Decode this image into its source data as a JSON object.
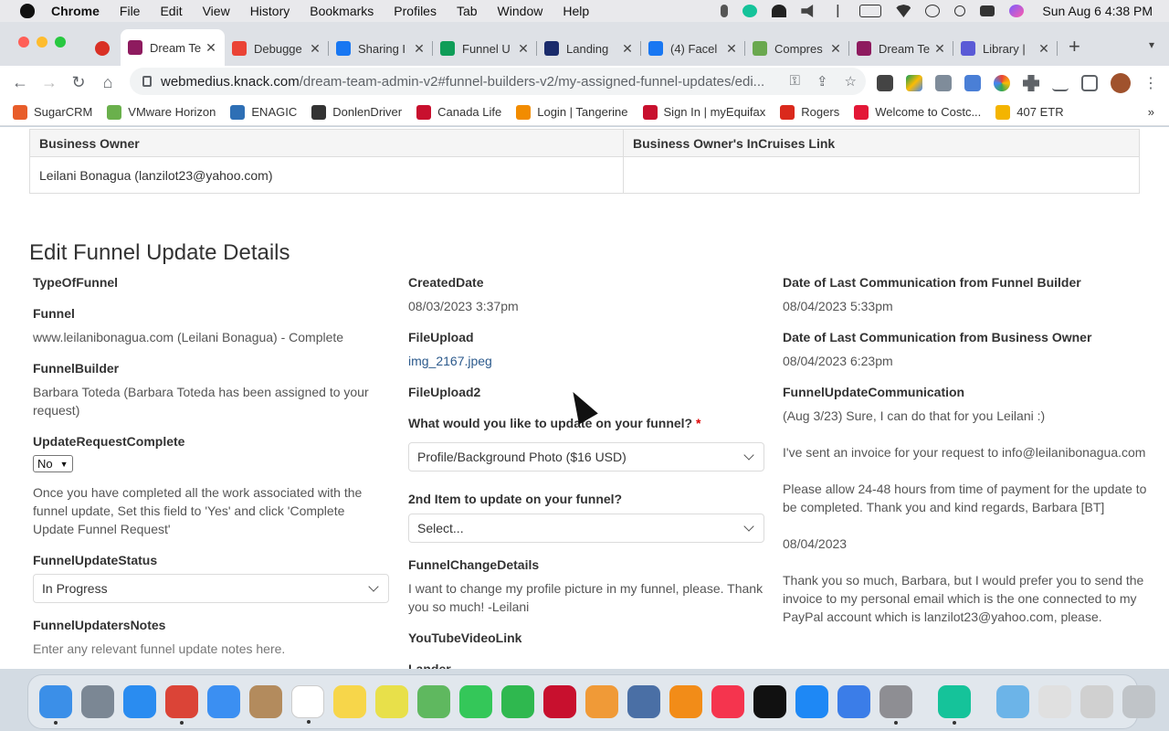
{
  "menubar": {
    "app_name": "Chrome",
    "items": [
      "File",
      "Edit",
      "View",
      "History",
      "Bookmarks",
      "Profiles",
      "Tab",
      "Window",
      "Help"
    ],
    "clock": "Sun Aug 6  4:38 PM"
  },
  "tabs": [
    {
      "title": "",
      "icon": "record-icon",
      "color": "#d93025"
    },
    {
      "title": "Dream Te",
      "icon": "knack-icon",
      "color": "#8e1b5f",
      "active": true
    },
    {
      "title": "Debugge",
      "icon": "gmail-icon",
      "color": "#ea4335"
    },
    {
      "title": "Sharing I",
      "icon": "facebook-icon",
      "color": "#1877f2"
    },
    {
      "title": "Funnel U",
      "icon": "sheets-icon",
      "color": "#0f9d58"
    },
    {
      "title": "Landing",
      "icon": "vimeo-icon",
      "color": "#1a2b6b"
    },
    {
      "title": "(4) Facel",
      "icon": "facebook-icon",
      "color": "#1877f2"
    },
    {
      "title": "Compres",
      "icon": "compress-icon",
      "color": "#6aa84f"
    },
    {
      "title": "Dream Te",
      "icon": "knack-icon",
      "color": "#8e1b5f"
    },
    {
      "title": "Library |",
      "icon": "library-icon",
      "color": "#5a5ad6"
    }
  ],
  "url": {
    "host": "webmedius.knack.com",
    "path": "/dream-team-admin-v2#funnel-builders-v2/my-assigned-funnel-updates/edi..."
  },
  "bookmarks": [
    {
      "label": "SugarCRM",
      "color": "#e85d2a"
    },
    {
      "label": "VMware Horizon",
      "color": "#6ab04c"
    },
    {
      "label": "ENAGIC",
      "color": "#2e6fb5"
    },
    {
      "label": "DonlenDriver",
      "color": "#333333"
    },
    {
      "label": "Canada Life",
      "color": "#c8102e"
    },
    {
      "label": "Login | Tangerine",
      "color": "#f28c00"
    },
    {
      "label": "Sign In | myEquifax",
      "color": "#c8102e"
    },
    {
      "label": "Rogers",
      "color": "#da291c"
    },
    {
      "label": "Welcome to Costc...",
      "color": "#e31837"
    },
    {
      "label": "407 ETR",
      "color": "#f4b400"
    }
  ],
  "owner_table": {
    "headers": [
      "Business Owner",
      "Business Owner's InCruises Link"
    ],
    "row": [
      "Leilani Bonagua (lanzilot23@yahoo.com)",
      ""
    ]
  },
  "section_title": "Edit Funnel Update Details",
  "col1": {
    "type_of_funnel_label": "TypeOfFunnel",
    "funnel_label": "Funnel",
    "funnel_value": "www.leilanibonagua.com (Leilani Bonagua) - Complete",
    "funnel_builder_label": "FunnelBuilder",
    "funnel_builder_value": "Barbara Toteda (Barbara Toteda has been assigned to your request)",
    "complete_label": "UpdateRequestComplete",
    "complete_value": "No",
    "complete_help": "Once you have completed all the work associated with the funnel update, Set this field to 'Yes' and click 'Complete Update Funnel Request'",
    "status_label": "FunnelUpdateStatus",
    "status_value": "In Progress",
    "notes_label": "FunnelUpdatersNotes",
    "notes_placeholder": "Enter any relevant funnel update notes here."
  },
  "col2": {
    "created_label": "CreatedDate",
    "created_value": "08/03/2023 3:37pm",
    "fileupload_label": "FileUpload",
    "fileupload_value": "img_2167.jpeg",
    "fileupload2_label": "FileUpload2",
    "update_q_label": "What would you like to update on your funnel?",
    "required_mark": "*",
    "update_q_value": "Profile/Background Photo ($16 USD)",
    "second_item_label": "2nd Item to update on your funnel?",
    "second_item_value": "Select...",
    "change_details_label": "FunnelChangeDetails",
    "change_details_value": "I want to change my profile picture in my funnel, please. Thank you so much! -Leilani",
    "youtube_label": "YouTubeVideoLink",
    "lander_label": "Lander"
  },
  "col3": {
    "last_fb_label": "Date of Last Communication from Funnel Builder",
    "last_fb_value": "08/04/2023 5:33pm",
    "last_bo_label": "Date of Last Communication from Business Owner",
    "last_bo_value": "08/04/2023 6:23pm",
    "comm_label": "FunnelUpdateCommunication",
    "comm_line1": "(Aug 3/23) Sure, I can do that for you Leilani :)",
    "comm_line2": "I've sent an invoice for your request to info@leilanibonagua.com",
    "comm_line3": "Please allow 24-48 hours from time of payment for the update to be completed. Thank you and kind regards, Barbara [BT]",
    "comm_line4": "08/04/2023",
    "comm_line5": "Thank you so much, Barbara, but I would prefer you to send the invoice to my personal email which is the one connected to my PayPal account which is lanzilot23@yahoo.com, please."
  },
  "dock": [
    {
      "name": "finder-icon",
      "color": "#3b8fe8",
      "running": true
    },
    {
      "name": "launchpad-icon",
      "color": "#7b8794"
    },
    {
      "name": "safari-icon",
      "color": "#2a8cf0"
    },
    {
      "name": "chrome-icon",
      "color": "#db4437",
      "running": true
    },
    {
      "name": "mail-icon",
      "color": "#3b8ff2"
    },
    {
      "name": "contacts-icon",
      "color": "#b38b5d"
    },
    {
      "name": "calendar-icon",
      "color": "#ffffff",
      "running": true
    },
    {
      "name": "notes-icon",
      "color": "#f7d64a"
    },
    {
      "name": "stickies-icon",
      "color": "#e8e04a"
    },
    {
      "name": "maps-icon",
      "color": "#5fb85f"
    },
    {
      "name": "messages-icon",
      "color": "#34c759"
    },
    {
      "name": "facetime-icon",
      "color": "#2fb84f"
    },
    {
      "name": "pdf-icon",
      "color": "#c8102e"
    },
    {
      "name": "photos-icon",
      "color": "#f09a37"
    },
    {
      "name": "quicktime-icon",
      "color": "#4a6fa5"
    },
    {
      "name": "books-icon",
      "color": "#f28c18"
    },
    {
      "name": "music-icon",
      "color": "#f5344e"
    },
    {
      "name": "appletv-icon",
      "color": "#111111"
    },
    {
      "name": "appstore-icon",
      "color": "#1e88f5"
    },
    {
      "name": "migration-icon",
      "color": "#3b7de8"
    },
    {
      "name": "system-settings-icon",
      "color": "#8e8e93",
      "running": true
    },
    {
      "name": "grammarly-icon",
      "color": "#15c39a",
      "running": true
    },
    {
      "name": "downloads-folder-icon",
      "color": "#6cb4e8"
    },
    {
      "name": "documents-stack-icon",
      "color": "#e0e0e0"
    },
    {
      "name": "recent-doc-icon",
      "color": "#d0d0d0"
    },
    {
      "name": "trash-icon",
      "color": "#c0c4c8"
    }
  ]
}
